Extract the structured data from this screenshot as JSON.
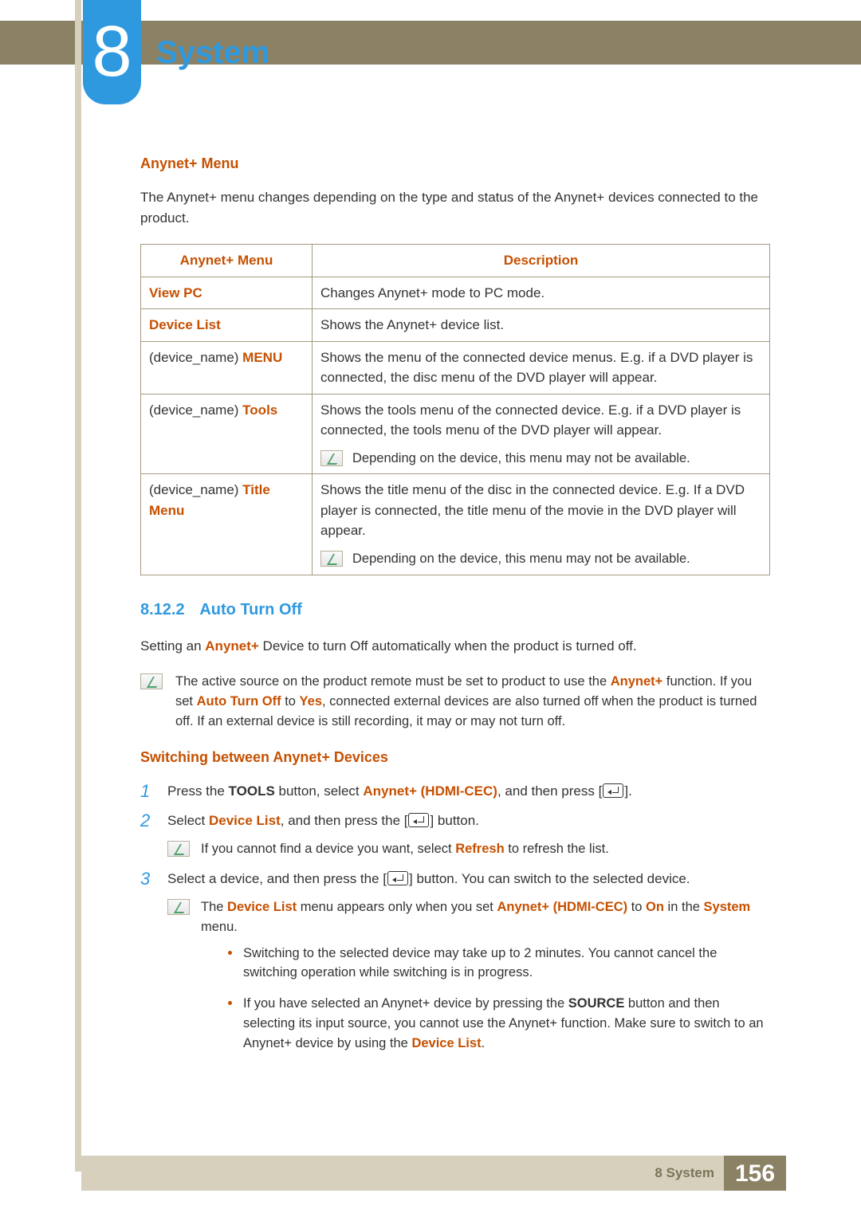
{
  "chapter": {
    "num": "8",
    "title": "System"
  },
  "s1": {
    "title": "Anynet+ Menu",
    "intro": "The Anynet+ menu changes depending on the type and status of the Anynet+ devices connected to the product."
  },
  "table": {
    "h1": "Anynet+ Menu",
    "h2": "Description",
    "r1": {
      "a": "View PC",
      "b": "Changes Anynet+ mode to PC mode."
    },
    "r2": {
      "a": "Device List",
      "b": "Shows the Anynet+ device list."
    },
    "r3": {
      "a1": "(device_name) ",
      "a2": "MENU",
      "b": "Shows the menu of the connected device menus. E.g. if a DVD player is connected, the disc menu of the DVD player will appear."
    },
    "r4": {
      "a1": "(device_name) ",
      "a2": "Tools",
      "b": "Shows the tools menu of the connected device. E.g. if a DVD player is connected, the tools menu of the DVD player will appear.",
      "note": "Depending on the device, this menu may not be available."
    },
    "r5": {
      "a1": "(device_name) ",
      "a2": "Title Menu",
      "b": "Shows the title menu of the disc in the connected device. E.g. If a DVD player is connected, the title menu of the movie in the DVD player will appear.",
      "note": "Depending on the device, this menu may not be available."
    }
  },
  "s2": {
    "num": "8.12.2",
    "title": "Auto Turn Off",
    "p_pre": "Setting an ",
    "p_em": "Anynet+",
    "p_post": " Device to turn Off automatically when the product is turned off.",
    "note_a": "The active source on the product remote must be set to product to use the ",
    "note_b": "Anynet+",
    "note_c": " function. If you set ",
    "note_d": "Auto Turn Off",
    "note_e": " to ",
    "note_f": "Yes",
    "note_g": ", connected external devices are also turned off when the product is turned off. If an external device is still recording, it may or may not turn off."
  },
  "s3": {
    "title": "Switching between Anynet+ Devices",
    "step1_a": "Press the ",
    "step1_b": "TOOLS",
    "step1_c": " button, select ",
    "step1_d": "Anynet+ (HDMI-CEC)",
    "step1_e": ", and then press [",
    "step1_f": "].",
    "step2_a": "Select ",
    "step2_b": "Device List",
    "step2_c": ", and then press the [",
    "step2_d": "] button.",
    "step2_note_a": "If you cannot find a device you want, select ",
    "step2_note_b": "Refresh",
    "step2_note_c": " to refresh the list.",
    "step3_a": "Select a device, and then press the [",
    "step3_b": "] button. You can switch to the selected device.",
    "step3_note_a": "The ",
    "step3_note_b": "Device List",
    "step3_note_c": " menu appears only when you set ",
    "step3_note_d": "Anynet+ (HDMI-CEC)",
    "step3_note_e": " to ",
    "step3_note_f": "On",
    "step3_note_g": " in the ",
    "step3_note_h": "System",
    "step3_note_i": " menu.",
    "bullet1": "Switching to the selected device may take up to 2 minutes. You cannot cancel the switching operation while switching is in progress.",
    "bullet2_a": "If you have selected an Anynet+ device by pressing the ",
    "bullet2_b": "SOURCE",
    "bullet2_c": " button and then selecting its input source, you cannot use the Anynet+ function. Make sure to switch to an Anynet+ device by using the ",
    "bullet2_d": "Device List",
    "bullet2_e": "."
  },
  "footer": {
    "label": "8 System",
    "page": "156"
  }
}
